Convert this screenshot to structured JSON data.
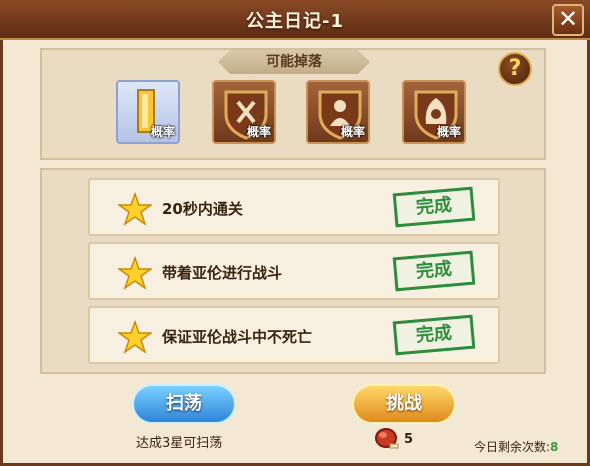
{
  "window": {
    "title": "公主日记-1"
  },
  "drops": {
    "banner": "可能掉落",
    "help": "?",
    "items": [
      {
        "icon": "gold-bars-icon",
        "label": "概率"
      },
      {
        "icon": "shield-axe-icon",
        "label": "概率"
      },
      {
        "icon": "shield-figure-icon",
        "label": "概率"
      },
      {
        "icon": "shield-hood-icon",
        "label": "概率"
      }
    ]
  },
  "tasks": [
    {
      "text": "20秒内通关",
      "status": "完成"
    },
    {
      "text": "带着亚伦进行战斗",
      "status": "完成"
    },
    {
      "text": "保证亚伦战斗中不死亡",
      "status": "完成"
    }
  ],
  "actions": {
    "sweep": "扫荡",
    "challenge": "挑战",
    "hint": "达成3星可扫荡",
    "stamina_cost": "5",
    "remaining_label": "今日剩余次数:",
    "remaining_value": "8"
  },
  "colors": {
    "accent_green": "#2e8c3c",
    "frame_brown": "#6b3a1e"
  }
}
